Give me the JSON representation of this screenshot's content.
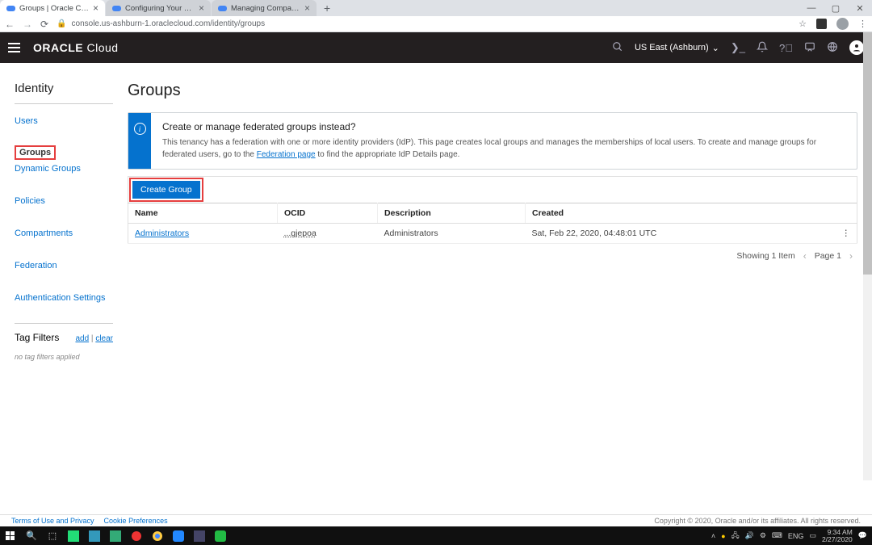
{
  "browser": {
    "tabs": [
      {
        "title": "Groups | Oracle Cloud Infrastru",
        "active": true
      },
      {
        "title": "Configuring Your Tenancy for D",
        "active": false
      },
      {
        "title": "Managing Compartments",
        "active": false
      }
    ],
    "url": "console.us-ashburn-1.oraclecloud.com/identity/groups"
  },
  "header": {
    "brand_bold": "ORACLE",
    "brand_light": "Cloud",
    "region": "US East (Ashburn)"
  },
  "sidebar": {
    "title": "Identity",
    "items": [
      "Users",
      "Groups",
      "Dynamic Groups",
      "Policies",
      "Compartments",
      "Federation",
      "Authentication Settings"
    ],
    "tag_filters": {
      "label": "Tag Filters",
      "add": "add",
      "clear": "clear",
      "empty": "no tag filters applied"
    }
  },
  "page": {
    "title": "Groups",
    "info_title": "Create or manage federated groups instead?",
    "info_body_1": "This tenancy has a federation with one or more identity providers (IdP). This page creates local groups and manages the memberships of local users. To create and manage groups for federated users, go to the ",
    "info_link": "Federation page",
    "info_body_2": " to find the appropriate IdP Details page.",
    "create_btn": "Create Group",
    "columns": {
      "name": "Name",
      "ocid": "OCID",
      "desc": "Description",
      "created": "Created"
    },
    "rows": [
      {
        "name": "Administrators",
        "ocid": "...gjepoa",
        "desc": "Administrators",
        "created": "Sat, Feb 22, 2020, 04:48:01 UTC"
      }
    ],
    "pagination": {
      "showing": "Showing 1 Item",
      "page": "Page 1"
    }
  },
  "footer": {
    "terms": "Terms of Use and Privacy",
    "cookies": "Cookie Preferences",
    "copy": "Copyright © 2020, Oracle and/or its affiliates. All rights reserved."
  },
  "taskbar": {
    "time": "9:34 AM",
    "date": "2/27/2020",
    "lang": "ENG"
  }
}
